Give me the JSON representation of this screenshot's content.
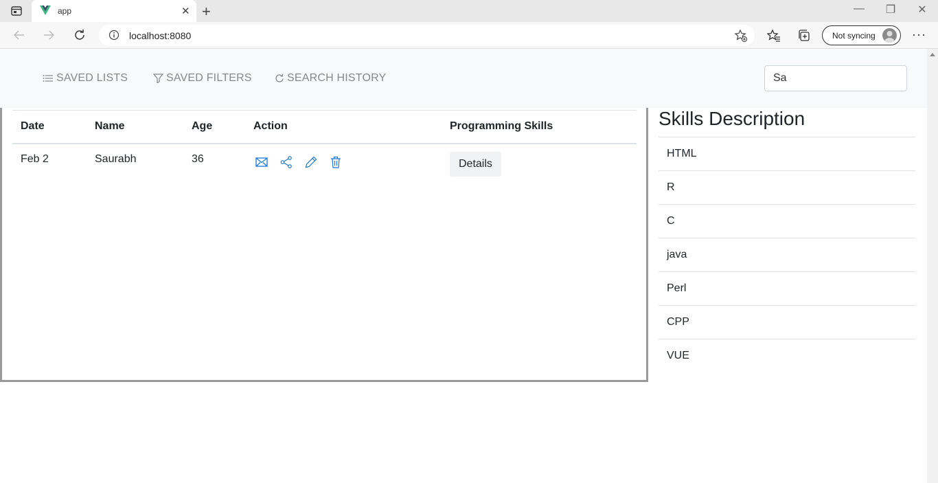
{
  "browser": {
    "tab_title": "app",
    "url": "localhost:8080",
    "sync_label": "Not syncing"
  },
  "nav": {
    "links": [
      {
        "label": "SAVED LISTS",
        "icon": "list-icon"
      },
      {
        "label": "SAVED FILTERS",
        "icon": "filter-icon"
      },
      {
        "label": "SEARCH HISTORY",
        "icon": "history-icon"
      }
    ],
    "search_value": "Sa"
  },
  "table": {
    "headers": [
      "Date",
      "Name",
      "Age",
      "Action",
      "Programming Skills"
    ],
    "rows": [
      {
        "date": "Feb 2",
        "name": "Saurabh",
        "age": "36",
        "details_label": "Details",
        "actions": [
          "mail-icon",
          "share-icon",
          "edit-icon",
          "trash-icon"
        ]
      }
    ]
  },
  "skills": {
    "title": "Skills Description",
    "items": [
      "HTML",
      "R",
      "C",
      "java",
      "Perl",
      "CPP",
      "VUE"
    ]
  },
  "colors": {
    "action_icon": "#1976d2",
    "navbar_bg": "#f8f9fa",
    "nav_link": "#888888"
  }
}
